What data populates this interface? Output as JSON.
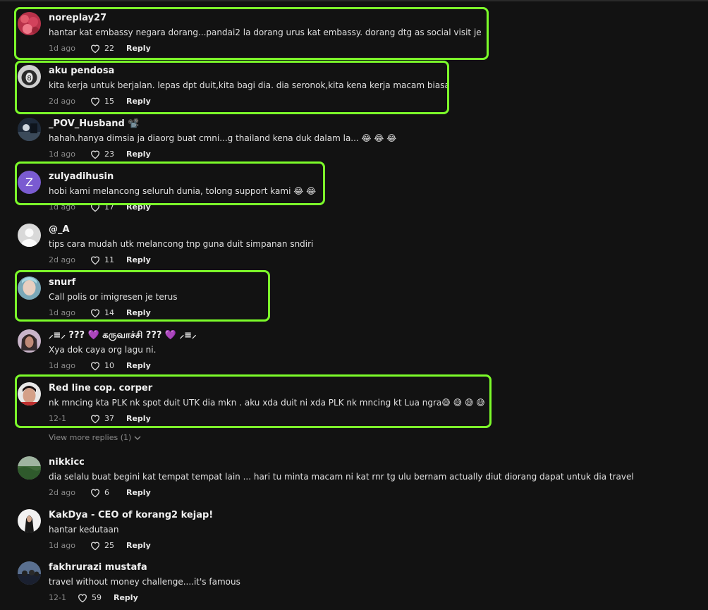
{
  "accent_color": "#7cfc2a",
  "like_icon": "heart-outline-icon",
  "comments": [
    {
      "user": "noreplay27",
      "text": "hantar kat embassy negara dorang...pandai2 la dorang urus kat embassy. dorang dtg as social visit je",
      "date": "1d ago",
      "likes": "22",
      "reply": "Reply"
    },
    {
      "user": "aku pendosa",
      "text": "kita kerja untuk berjalan. lepas dpt duit,kita bagi dia. dia seronok,kita kena kerja macam biasa",
      "date": "2d ago",
      "likes": "15",
      "reply": "Reply"
    },
    {
      "user": "_POV_Husband 📽️",
      "text": "hahah.hanya dimsia ja diaorg buat cmni...g thailand kena duk dalam la... 😂 😂 😂",
      "date": "1d ago",
      "likes": "23",
      "reply": "Reply"
    },
    {
      "user": "zulyadihusin",
      "avatar_letter": "Z",
      "text": "hobi kami melancong seluruh dunia, tolong support kami 😂 😂",
      "date": "1d ago",
      "likes": "17",
      "reply": "Reply"
    },
    {
      "user": "@_A",
      "text": "tips cara mudah utk melancong tnp guna duit simpanan sndiri",
      "date": "2d ago",
      "likes": "11",
      "reply": "Reply"
    },
    {
      "user": "snurf",
      "text": "Call polis or imigresen je terus",
      "date": "1d ago",
      "likes": "14",
      "reply": "Reply"
    },
    {
      "user": "⸝≡⸝ ??? 💜 கருவாச்சி ??? 💜 ⸝≡⸝",
      "text": "Xya dok caya org lagu ni.",
      "date": "1d ago",
      "likes": "10",
      "reply": "Reply"
    },
    {
      "user": "Red line cop. corper",
      "text": "nk mncing kta PLK nk spot duit UTK dia mkn . aku xda duit ni xda PLK nk mncing kt Lua ngra😅 😅 😅 😅",
      "date": "12-1",
      "likes": "37",
      "reply": "Reply"
    },
    {
      "user": "nikkicc",
      "text": "dia selalu buat begini kat tempat tempat lain ... hari tu minta macam ni kat rnr tg ulu bernam actually diut diorang dapat untuk dia travel",
      "date": "2d ago",
      "likes": "6",
      "reply": "Reply"
    },
    {
      "user": "KakDya - CEO of korang2 kejap!",
      "text": "hantar kedutaan",
      "date": "1d ago",
      "likes": "25",
      "reply": "Reply"
    },
    {
      "user": "fakhrurazi mustafa",
      "text": "travel without money challenge....it's famous",
      "date": "12-1",
      "likes": "59",
      "reply": "Reply"
    }
  ],
  "view_more": "View more replies (1)"
}
